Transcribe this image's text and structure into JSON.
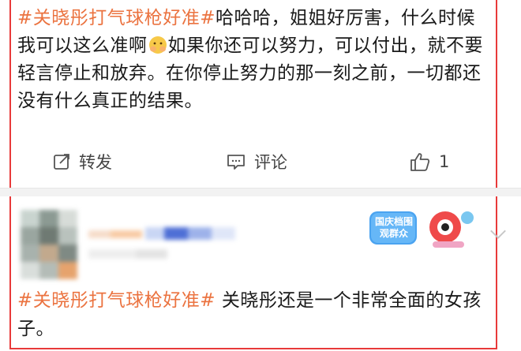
{
  "post": {
    "hashtag": "#关晓彤打气球枪好准#",
    "text_before_emoji": "哈哈哈，姐姐好厉害，什么时候我可以这么准啊",
    "emoji": "face-hands-emoji",
    "text_after_emoji": "如果你还可以努力，可以付出，就不要轻言停止和放弃。在你停止努力的那一刻之前，一切都还没有什么真正的结果。"
  },
  "actions": {
    "repost_label": "转发",
    "comment_label": "评论",
    "like_count": "1"
  },
  "comment": {
    "badge_text": "国庆档围观群众",
    "hashtag": "#关晓彤打气球枪好准#",
    "text": " 关晓彤还是一个非常全面的女孩子。"
  },
  "colors": {
    "hashtag": "#eb7340",
    "frame": "#e83a3a"
  }
}
